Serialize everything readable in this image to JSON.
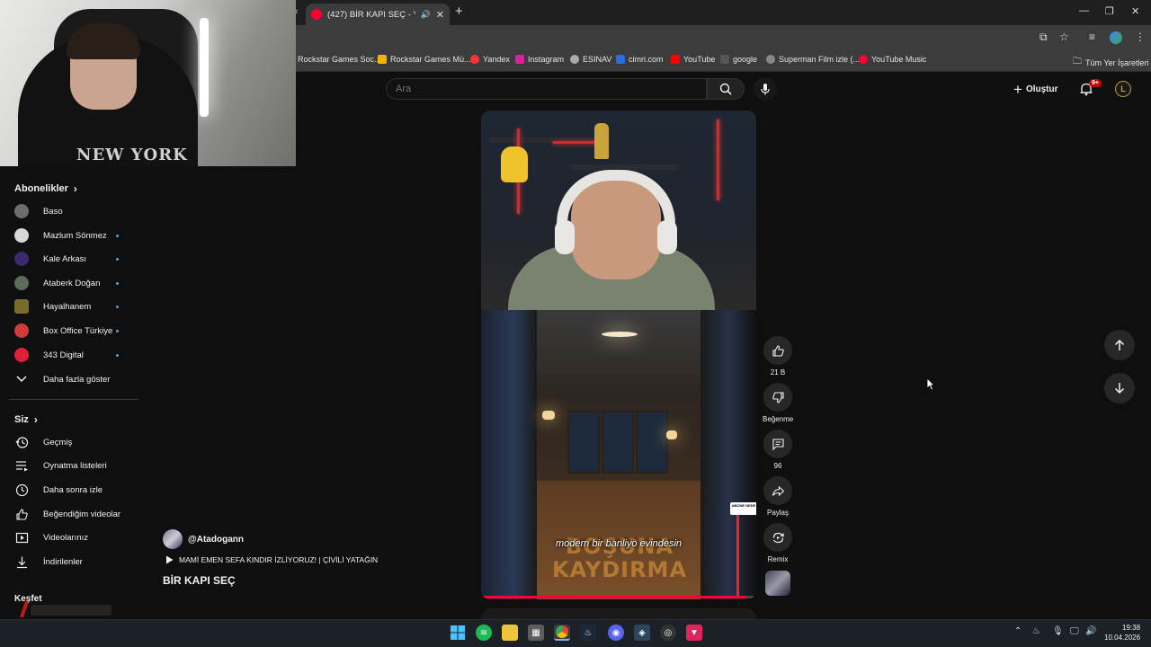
{
  "browser": {
    "tab_title": "(427) BİR KAPI SEÇ - YouTube",
    "bookmarks": [
      {
        "label": "Rockstar Games Soc...",
        "color": "#f4b400"
      },
      {
        "label": "Rockstar Games Mü...",
        "color": "#f4b400"
      },
      {
        "label": "Yandex",
        "color": "#ff3333"
      },
      {
        "label": "Instagram",
        "color": "#d6249f"
      },
      {
        "label": "ESINAV",
        "color": "#aaaaaa"
      },
      {
        "label": "cimri.com",
        "color": "#2d6cdf"
      },
      {
        "label": "YouTube",
        "color": "#ff0000"
      },
      {
        "label": "google",
        "color": "#555555"
      },
      {
        "label": "Superman Film izle (...",
        "color": "#888888"
      },
      {
        "label": "YouTube Music",
        "color": "#ff0033"
      }
    ],
    "all_bookmarks": "Tüm Yer İşaretleri"
  },
  "header": {
    "search_placeholder": "Ara",
    "create_label": "Oluştur",
    "notif_badge": "9+",
    "avatar_letter": "L"
  },
  "sidebar": {
    "subscriptions_title": "Abonelikler",
    "subscriptions": [
      {
        "name": "Baso",
        "color": "#6d6d6d",
        "dot": false
      },
      {
        "name": "Mazlum Sönmez",
        "color": "#d8d8d8",
        "dot": true
      },
      {
        "name": "Kale Arkası",
        "color": "#3b2a6e",
        "dot": true
      },
      {
        "name": "Ataberk Doğan",
        "color": "#5d6b5a",
        "dot": true
      },
      {
        "name": "Hayalhanem",
        "color": "#7a6a2e",
        "dot": true
      },
      {
        "name": "Box Office Türkiye",
        "color": "#d23a3a",
        "dot": true
      },
      {
        "name": "343 Digital",
        "color": "#e0203a",
        "dot": true
      }
    ],
    "show_more": "Daha fazla göster",
    "you_title": "Siz",
    "you_items": [
      {
        "name": "Geçmiş",
        "icon": "history-icon"
      },
      {
        "name": "Oynatma listeleri",
        "icon": "playlist-icon"
      },
      {
        "name": "Daha sonra izle",
        "icon": "clock-icon"
      },
      {
        "name": "Beğendiğim videolar",
        "icon": "thumbs-up-icon"
      },
      {
        "name": "Videolarınız",
        "icon": "video-icon"
      },
      {
        "name": "İndirilenler",
        "icon": "download-icon"
      }
    ],
    "explore_title": "Keşfet"
  },
  "short": {
    "channel_handle": "@Atadogann",
    "music": "MAMİ EMEN SEFA KINDIR İZLİYORUZ! | ÇİVİLİ YATAĞIN",
    "title": "BİR KAPI SEÇ",
    "subtitle": "modern bir banliyö evindesin",
    "watermark": "BOŞUNA KAYDIRMA",
    "abone_text": "ABONE NEDE",
    "progress": 0.96
  },
  "actions": {
    "likes": "21 B",
    "dislike_label": "Beğenme",
    "comments": "96",
    "share_label": "Paylaş",
    "remix_label": "Remix"
  },
  "webcam": {
    "shirt_text": "NEW YORK"
  },
  "clock": {
    "time": "19:38",
    "date": "10.04.2026"
  },
  "colors": {
    "background": "#0f0f0f",
    "accent_red": "#ff0033",
    "link_blue": "#3ea6ff"
  }
}
